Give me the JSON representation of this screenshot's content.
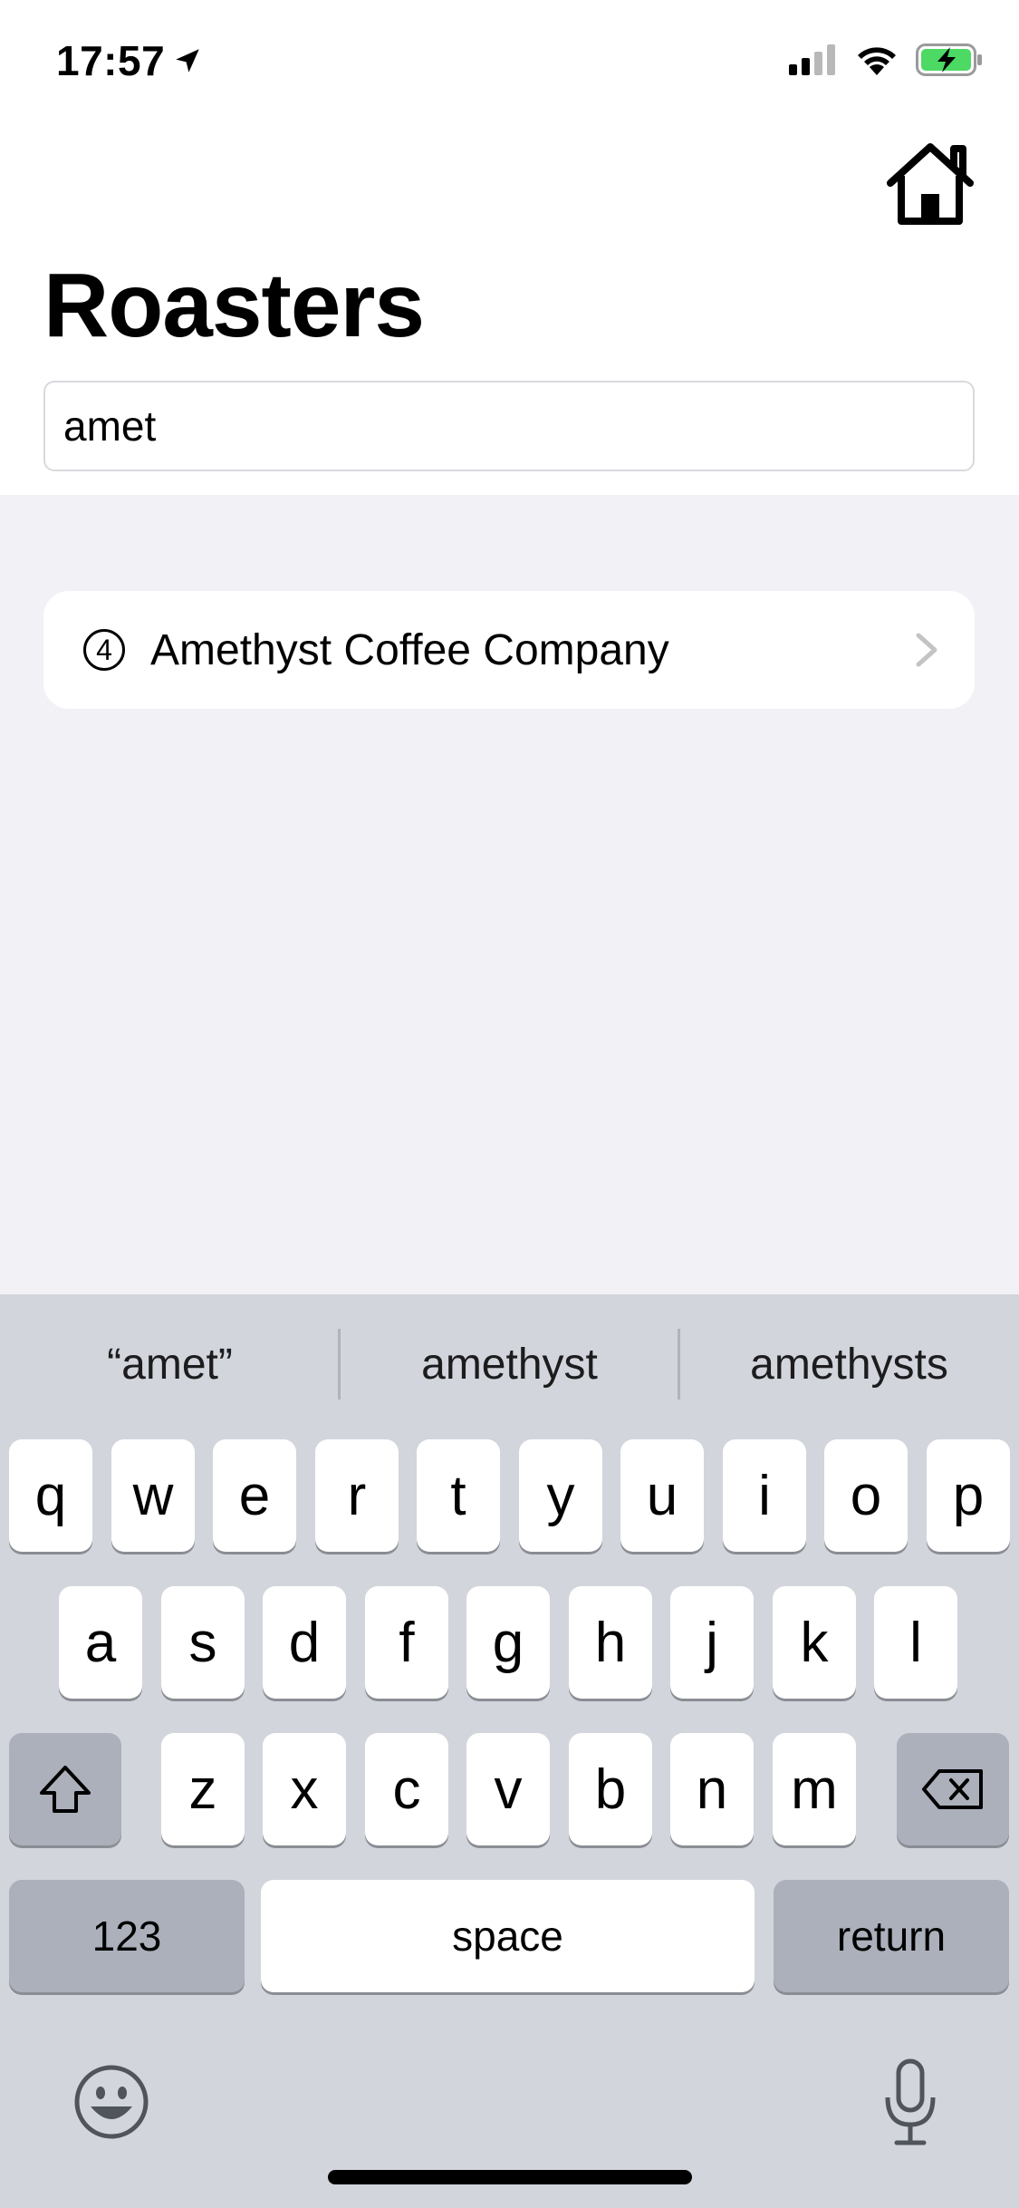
{
  "status_bar": {
    "time": "17:57",
    "location_icon": "location-arrow-icon",
    "signal_icon": "cellular-signal-icon",
    "wifi_icon": "wifi-icon",
    "battery_icon": "battery-charging-icon",
    "battery_color": "#4cd964"
  },
  "header": {
    "home_icon": "house-icon",
    "title": "Roasters"
  },
  "search": {
    "value": "amet",
    "placeholder": ""
  },
  "results": [
    {
      "badge": "4",
      "label": "Amethyst Coffee Company"
    }
  ],
  "keyboard": {
    "suggestions": [
      "“amet”",
      "amethyst",
      "amethysts"
    ],
    "row1": [
      "q",
      "w",
      "e",
      "r",
      "t",
      "y",
      "u",
      "i",
      "o",
      "p"
    ],
    "row2": [
      "a",
      "s",
      "d",
      "f",
      "g",
      "h",
      "j",
      "k",
      "l"
    ],
    "row3": [
      "z",
      "x",
      "c",
      "v",
      "b",
      "n",
      "m"
    ],
    "numbers_label": "123",
    "space_label": "space",
    "return_label": "return",
    "shift_icon": "shift-icon",
    "delete_icon": "backspace-icon",
    "emoji_icon": "emoji-icon",
    "mic_icon": "microphone-icon"
  },
  "colors": {
    "background": "#f1f1f6",
    "keyboard_background": "#d2d5db",
    "special_key": "#abb0bb"
  }
}
